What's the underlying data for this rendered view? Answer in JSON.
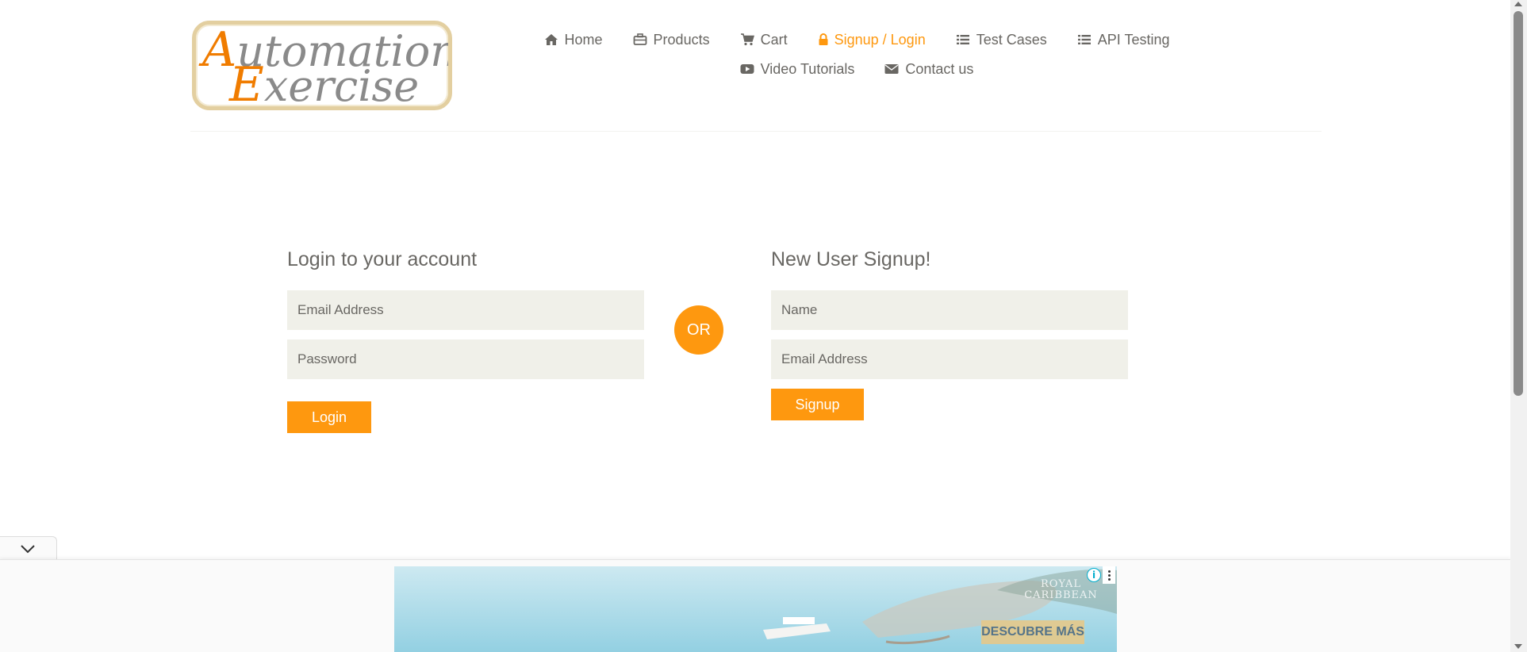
{
  "logo": {
    "line1": "Automation",
    "line2": "Exercise"
  },
  "nav": {
    "items": [
      {
        "label": "Home",
        "icon": "home-icon",
        "active": false
      },
      {
        "label": "Products",
        "icon": "briefcase-icon",
        "active": false
      },
      {
        "label": "Cart",
        "icon": "cart-icon",
        "active": false
      },
      {
        "label": "Signup / Login",
        "icon": "lock-icon",
        "active": true
      },
      {
        "label": "Test Cases",
        "icon": "list-icon",
        "active": false
      },
      {
        "label": "API Testing",
        "icon": "list-icon",
        "active": false
      },
      {
        "label": "Video Tutorials",
        "icon": "youtube-icon",
        "active": false
      },
      {
        "label": "Contact us",
        "icon": "envelope-icon",
        "active": false
      }
    ]
  },
  "login": {
    "title": "Login to your account",
    "email_placeholder": "Email Address",
    "password_placeholder": "Password",
    "button_label": "Login"
  },
  "or_label": "OR",
  "signup": {
    "title": "New User Signup!",
    "name_placeholder": "Name",
    "email_placeholder": "Email Address",
    "button_label": "Signup"
  },
  "ad": {
    "brand": "ROYAL CARIBBEAN",
    "cta": "DESCUBRE MÁS",
    "info_icon": "info-icon",
    "more_icon": "more-vertical-icon",
    "collapse_icon": "chevron-down-icon"
  },
  "colors": {
    "accent": "#fe980f",
    "text": "#696763",
    "input_bg": "#f0f0e9"
  }
}
